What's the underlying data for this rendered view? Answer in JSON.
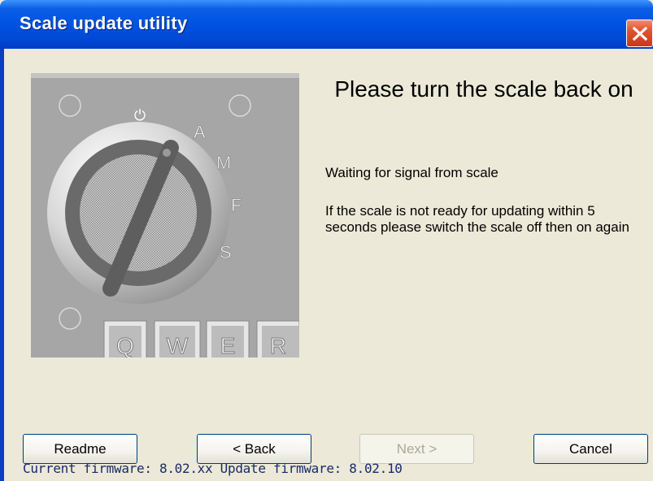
{
  "window": {
    "title": "Scale update utility"
  },
  "main": {
    "headline": "Please turn the scale back on",
    "status": "Waiting for signal from scale",
    "instructions": "If the scale is not ready for updating within 5 seconds please switch the scale off then on again"
  },
  "dial": {
    "labels": [
      "A",
      "M",
      "F",
      "S"
    ],
    "keys": [
      "Q",
      "W",
      "E",
      "R"
    ],
    "power_symbol": "⏻"
  },
  "buttons": {
    "readme": "Readme",
    "back": "< Back",
    "next": "Next >",
    "cancel": "Cancel"
  },
  "footer": {
    "firmware_text": "Current firmware: 8.02.xx Update firmware: 8.02.10"
  },
  "colors": {
    "title_bar": "#0054e3",
    "close_button": "#e0532f",
    "panel": "#ece9d8"
  }
}
